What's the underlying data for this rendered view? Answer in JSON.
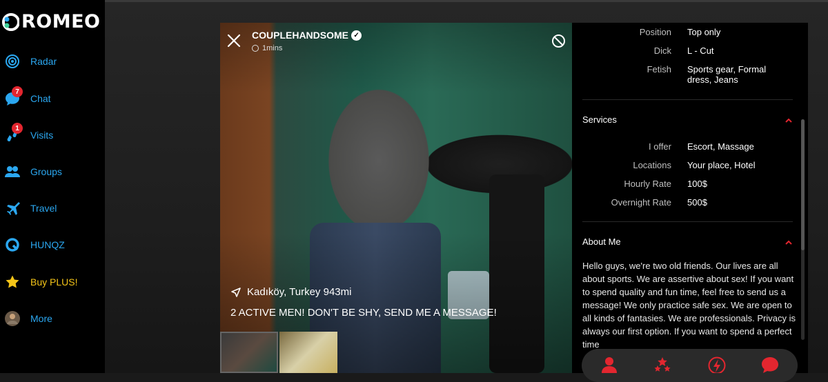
{
  "app": {
    "name": "ROMEO"
  },
  "colors": {
    "accent": "#2ba7f0",
    "plus": "#f5c518",
    "badge": "#e3262f",
    "action": "#e3262f"
  },
  "sidebar": {
    "items": [
      {
        "label": "Radar",
        "icon": "radar-icon"
      },
      {
        "label": "Chat",
        "icon": "chat-icon",
        "badge": "7"
      },
      {
        "label": "Visits",
        "icon": "visits-icon",
        "badge": "1"
      },
      {
        "label": "Groups",
        "icon": "groups-icon"
      },
      {
        "label": "Travel",
        "icon": "plane-icon"
      },
      {
        "label": "HUNQZ",
        "icon": "hunqz-icon"
      },
      {
        "label": "Buy PLUS!",
        "icon": "star-icon"
      },
      {
        "label": "More",
        "icon": "avatar-icon"
      }
    ]
  },
  "profile": {
    "username": "COUPLEHANDSOME",
    "last_seen": "1mins",
    "location": "Kadıköy, Turkey 943mi",
    "headline": "2 ACTIVE MEN! DON'T BE SHY, SEND ME A MESSAGE!"
  },
  "details": {
    "sexual": [
      {
        "key": "Position",
        "value": "Top only"
      },
      {
        "key": "Dick",
        "value": "L - Cut"
      },
      {
        "key": "Fetish",
        "value": "Sports gear, Formal dress, Jeans"
      }
    ],
    "services_title": "Services",
    "services": [
      {
        "key": "I offer",
        "value": "Escort, Massage"
      },
      {
        "key": "Locations",
        "value": "Your place, Hotel"
      },
      {
        "key": "Hourly Rate",
        "value": "100$"
      },
      {
        "key": "Overnight Rate",
        "value": "500$"
      }
    ],
    "about_title": "About Me",
    "about_text": "Hello guys, we're two old friends. Our lives are all about sports. We are assertive about sex! If you want to spend quality and fun time, feel free to send us a message! We only practice safe sex. We are open to all kinds of fantasies. We are professionals. Privacy is always our first option. If you want to spend a perfect time"
  },
  "actions": [
    {
      "icon": "profile-icon"
    },
    {
      "icon": "stars-icon"
    },
    {
      "icon": "lightning-icon"
    },
    {
      "icon": "message-icon"
    }
  ]
}
